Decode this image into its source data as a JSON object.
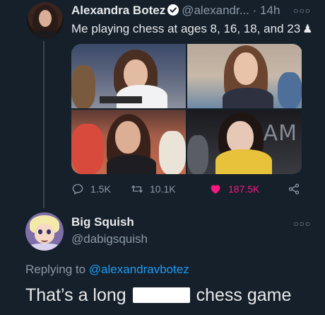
{
  "tweet": {
    "author_name": "Alexandra Botez",
    "author_handle": "@alexandr...",
    "separator": "·",
    "time": "14h",
    "text": "Me playing chess at ages 8, 16, 18, and 23",
    "emoji": "♟",
    "stats": {
      "replies": "1.5K",
      "retweets": "10.1K",
      "likes": "187.5K"
    },
    "photo_overlay_text": "AM"
  },
  "reply": {
    "author_name": "Big Squish",
    "author_handle": "@dabigsquish",
    "replying_prefix": "Replying to",
    "replying_to": "@alexandravbotez",
    "text_before": "That’s a long",
    "text_after": "chess game"
  },
  "colors": {
    "background": "#15202b",
    "accent": "#1d9bf0",
    "like": "#f91880",
    "muted": "#8b98a5"
  },
  "icons": [
    "verified-badge-icon",
    "more-icon",
    "reply-icon",
    "retweet-icon",
    "heart-icon",
    "share-icon"
  ]
}
